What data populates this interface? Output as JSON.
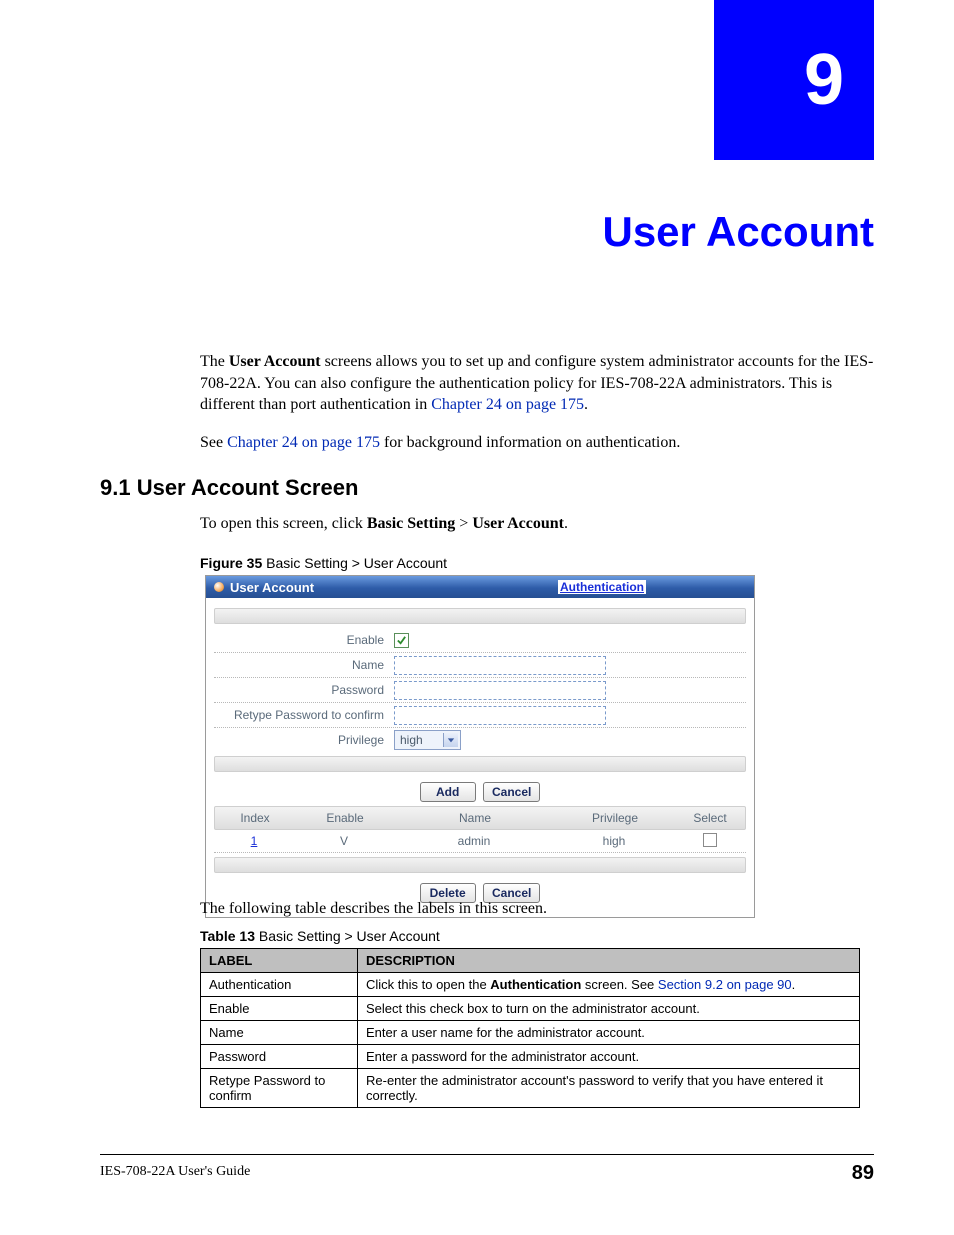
{
  "chapter": {
    "number": "9",
    "title": "User Account"
  },
  "intro": {
    "p1_a": "The ",
    "p1_b_bold": "User Account",
    "p1_c": " screens allows you to set up and configure system administrator accounts for the IES-708-22A. You can also configure the authentication policy for IES-708-22A administrators. This is different than port authentication in ",
    "p1_link": "Chapter 24 on page 175",
    "p1_d": ".",
    "p2_a": "See ",
    "p2_link": "Chapter 24 on page 175",
    "p2_b": " for background information on authentication."
  },
  "section": {
    "heading": "9.1  User Account Screen",
    "intro_a": "To open this screen, click ",
    "intro_b_bold": "Basic Setting",
    "intro_c": " > ",
    "intro_d_bold": "User Account",
    "intro_e": "."
  },
  "figure": {
    "caption_bold": "Figure 35",
    "caption_rest": "   Basic Setting > User Account"
  },
  "panel": {
    "header_title": "User Account",
    "header_link": "Authentication",
    "labels": {
      "enable": "Enable",
      "name": "Name",
      "password": "Password",
      "retype": "Retype Password to confirm",
      "privilege": "Privilege"
    },
    "privilege_value": "high",
    "buttons": {
      "add": "Add",
      "cancel": "Cancel",
      "delete": "Delete",
      "cancel2": "Cancel"
    },
    "list": {
      "headers": {
        "index": "Index",
        "enable": "Enable",
        "name": "Name",
        "privilege": "Privilege",
        "select": "Select"
      },
      "row1": {
        "index": "1",
        "enable": "V",
        "name": "admin",
        "privilege": "high"
      }
    }
  },
  "after_figure_text": "The following table describes the labels in this screen.",
  "table": {
    "caption_bold": "Table 13",
    "caption_rest": "   Basic Setting > User Account",
    "head_label": "LABEL",
    "head_desc": "DESCRIPTION",
    "rows": [
      {
        "label": "Authentication",
        "desc_a": "Click this to open the ",
        "desc_bold": "Authentication",
        "desc_b": " screen. See ",
        "desc_link": "Section 9.2 on page 90",
        "desc_c": "."
      },
      {
        "label": "Enable",
        "desc_a": "Select this check box to turn on the administrator account.",
        "desc_bold": "",
        "desc_b": "",
        "desc_link": "",
        "desc_c": ""
      },
      {
        "label": "Name",
        "desc_a": "Enter a user name for the administrator account.",
        "desc_bold": "",
        "desc_b": "",
        "desc_link": "",
        "desc_c": ""
      },
      {
        "label": "Password",
        "desc_a": "Enter a password for the administrator account.",
        "desc_bold": "",
        "desc_b": "",
        "desc_link": "",
        "desc_c": ""
      },
      {
        "label": "Retype Password to confirm",
        "desc_a": "Re-enter the administrator account's password to verify that you have entered it correctly.",
        "desc_bold": "",
        "desc_b": "",
        "desc_link": "",
        "desc_c": ""
      }
    ]
  },
  "footer": {
    "left": "IES-708-22A User's Guide",
    "right": "89"
  }
}
